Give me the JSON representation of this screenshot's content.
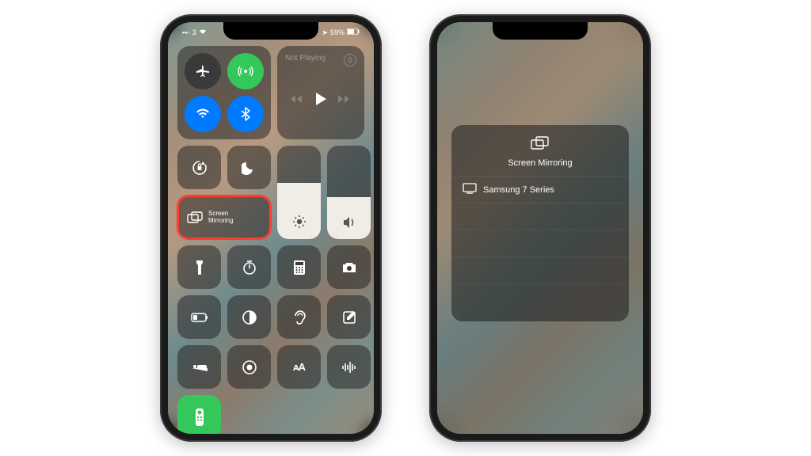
{
  "statusbar": {
    "carrier": "3",
    "battery_text": "59%",
    "alarm": true,
    "location": true
  },
  "connectivity": {
    "airplane": {
      "active": false
    },
    "cellular": {
      "active": true
    },
    "wifi": {
      "active": true
    },
    "bluetooth": {
      "active": true
    }
  },
  "media": {
    "status_label": "Not Playing"
  },
  "mirror": {
    "label_line1": "Screen",
    "label_line2": "Mirroring"
  },
  "panel": {
    "title": "Screen Mirroring",
    "devices": [
      {
        "name": "Samsung 7 Series"
      }
    ]
  }
}
